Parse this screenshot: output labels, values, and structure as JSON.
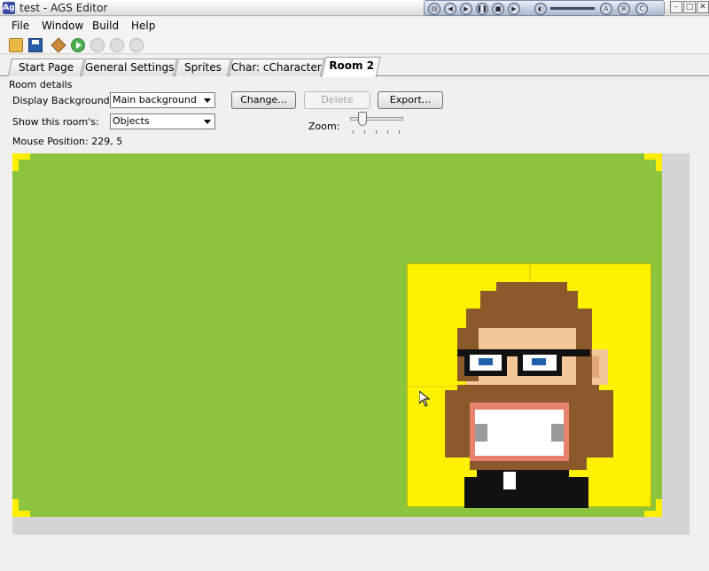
{
  "window": {
    "title": "test - AGS Editor"
  },
  "menu": {
    "file": "File",
    "window": "Window",
    "build": "Build",
    "help": "Help"
  },
  "tabs": [
    {
      "label": "Start Page"
    },
    {
      "label": "General Settings"
    },
    {
      "label": "Sprites"
    },
    {
      "label": "Char: cCharacter"
    },
    {
      "label": "Room 2"
    }
  ],
  "room_details": {
    "group_label": "Room details",
    "display_background_label": "Display Background:",
    "display_background_value": "Main background",
    "show_rooms_label": "Show this room's:",
    "show_rooms_value": "Objects",
    "change_button": "Change...",
    "delete_button": "Delete",
    "export_button": "Export...",
    "zoom_label": "Zoom:",
    "mouse_position": "Mouse Position: 229, 5"
  },
  "colors": {
    "room_background": "#8cc43e",
    "sprite_background": "#fff200",
    "corner_marker": "#ffee00"
  },
  "icons": {
    "toolbar": [
      "open-icon",
      "save-icon",
      "build-icon",
      "run-icon",
      "pause-icon",
      "step-icon",
      "stop-icon"
    ]
  }
}
